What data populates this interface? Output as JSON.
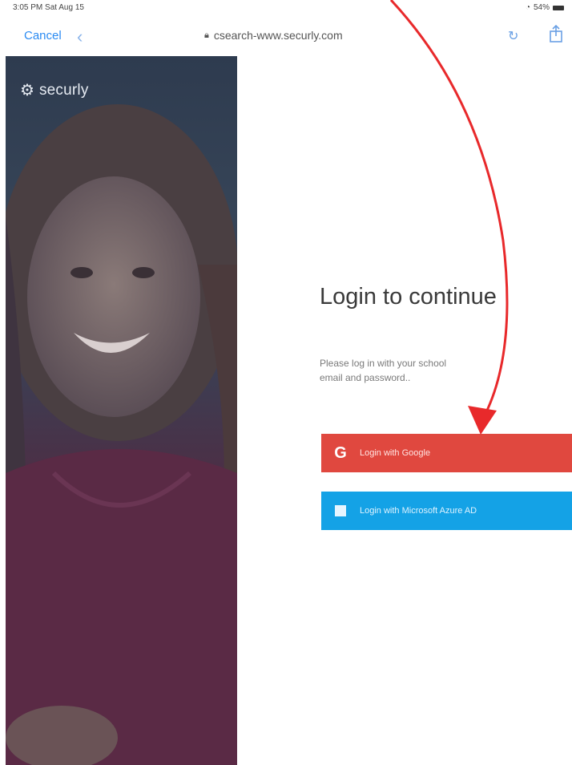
{
  "status_bar": {
    "time": "3:05 PM  Sat Aug 15",
    "battery": "54%"
  },
  "browser": {
    "cancel_label": "Cancel",
    "url": "csearch-www.securly.com",
    "icons": {
      "back": "chevron-left-icon",
      "lock": "lock-icon",
      "reload": "reload-icon",
      "share": "share-icon"
    }
  },
  "brand": {
    "name": "securly",
    "icon": "securly-logo-icon"
  },
  "login": {
    "title": "Login to continue",
    "subtitle": "Please log in with your school email and password..",
    "google_button": {
      "label": "Login with Google",
      "icon": "google-g-icon",
      "color": "#e0483f"
    },
    "microsoft_button": {
      "label": "Login with Microsoft Azure AD",
      "icon": "microsoft-icon",
      "color": "#14a2e6"
    }
  },
  "colors": {
    "accent_link": "#2b8bf2",
    "annotation_arrow": "#e8292b",
    "panel_overlay": "#2e3b4f"
  }
}
